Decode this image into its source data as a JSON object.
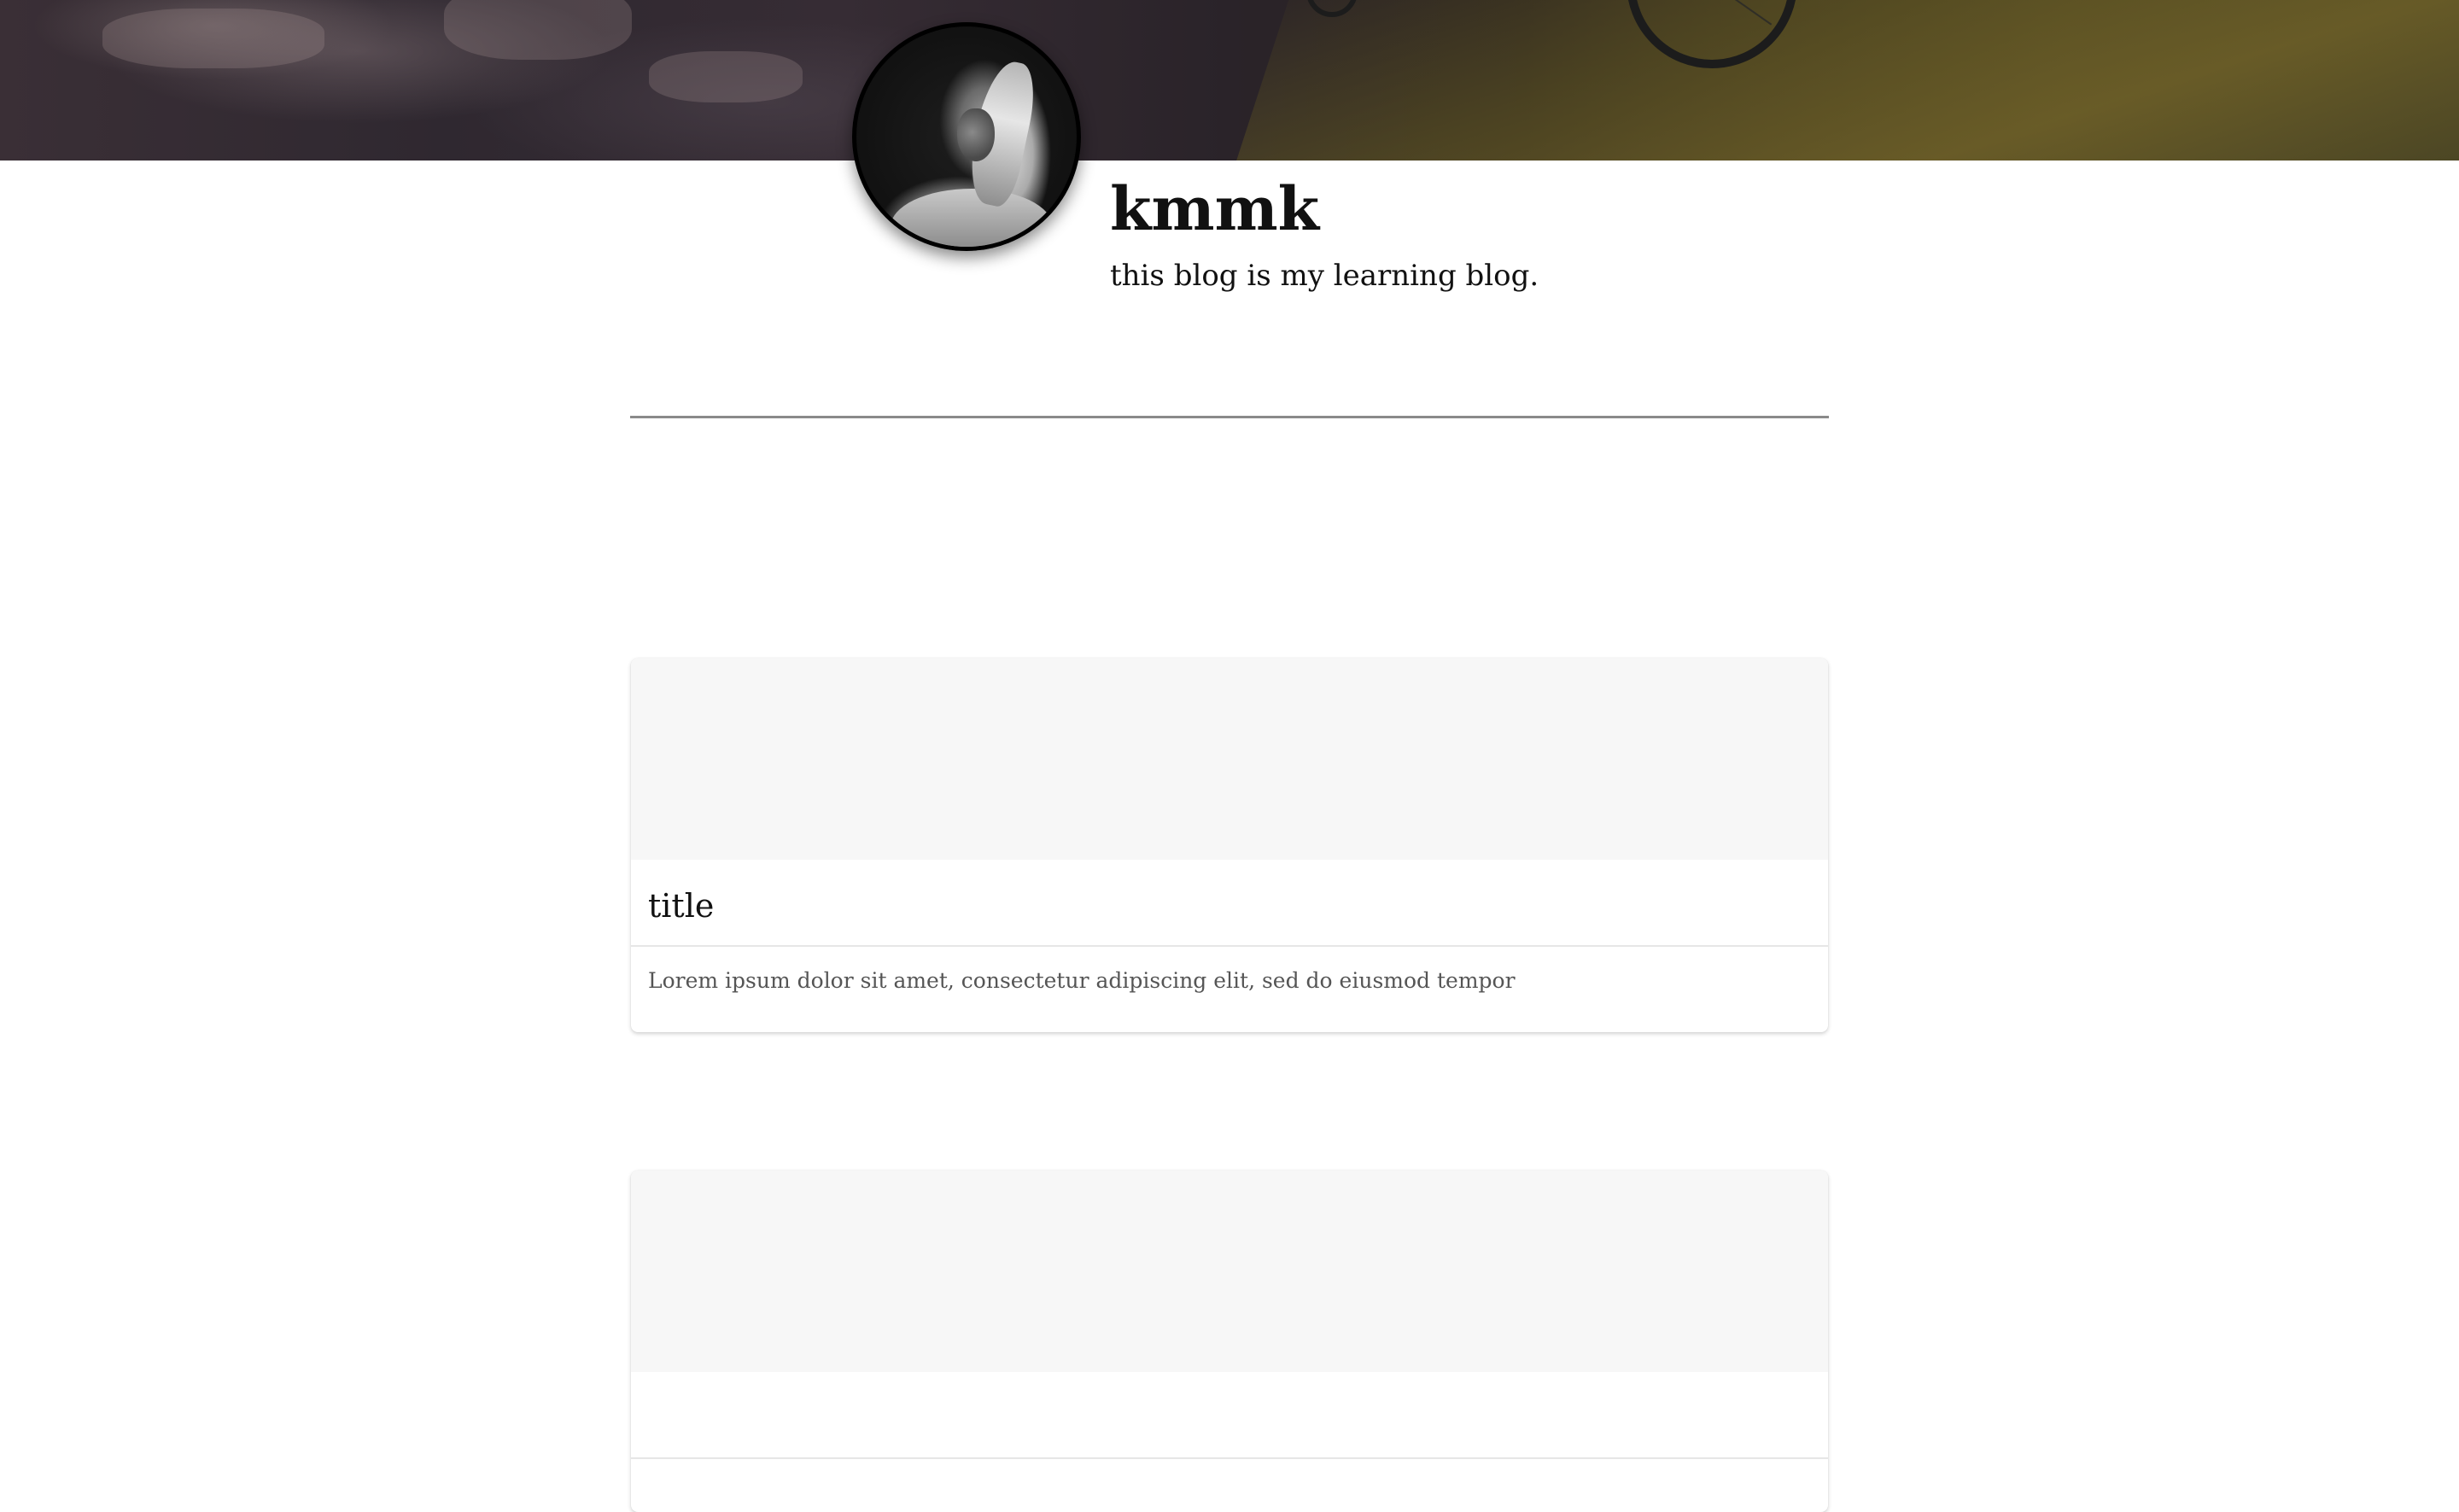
{
  "profile": {
    "name": "kmmk",
    "tagline": "this blog is my learning blog."
  },
  "posts": [
    {
      "title": "title",
      "excerpt": "Lorem ipsum dolor sit amet, consectetur adipiscing elit, sed do eiusmod tempor"
    },
    {
      "title": "",
      "excerpt": ""
    }
  ],
  "colors": {
    "background": "#ffffff",
    "text": "#111111",
    "excerpt_text": "#555555",
    "divider": "#8a8a8a",
    "card_image_placeholder": "#f7f7f7"
  },
  "icons": {
    "avatar": "profile-photo"
  }
}
